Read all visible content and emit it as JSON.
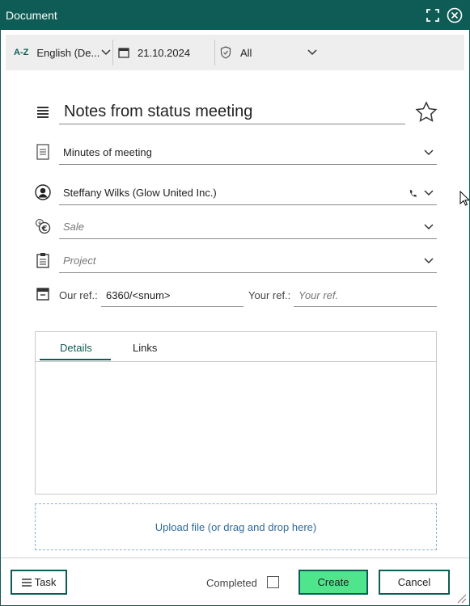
{
  "window": {
    "title": "Document"
  },
  "toolbar": {
    "language": "English (De...",
    "date": "21.10.2024",
    "access": "All"
  },
  "form": {
    "title": "Notes from status meeting",
    "document_type": "Minutes of meeting",
    "contact": "Steffany Wilks (Glow United Inc.)",
    "sale_placeholder": "Sale",
    "project_placeholder": "Project",
    "our_ref_label": "Our ref.:",
    "our_ref_value": "6360/<snum>",
    "your_ref_label": "Your ref.:",
    "your_ref_placeholder": "Your ref."
  },
  "tabs": [
    {
      "label": "Details",
      "active": true
    },
    {
      "label": "Links",
      "active": false
    }
  ],
  "upload": {
    "label": "Upload file (or drag and drop here)"
  },
  "footer": {
    "task_label": "Task",
    "completed_label": "Completed",
    "create_label": "Create",
    "cancel_label": "Cancel"
  },
  "colors": {
    "accent": "#0e5c55",
    "create_bg": "#4ee58c"
  }
}
